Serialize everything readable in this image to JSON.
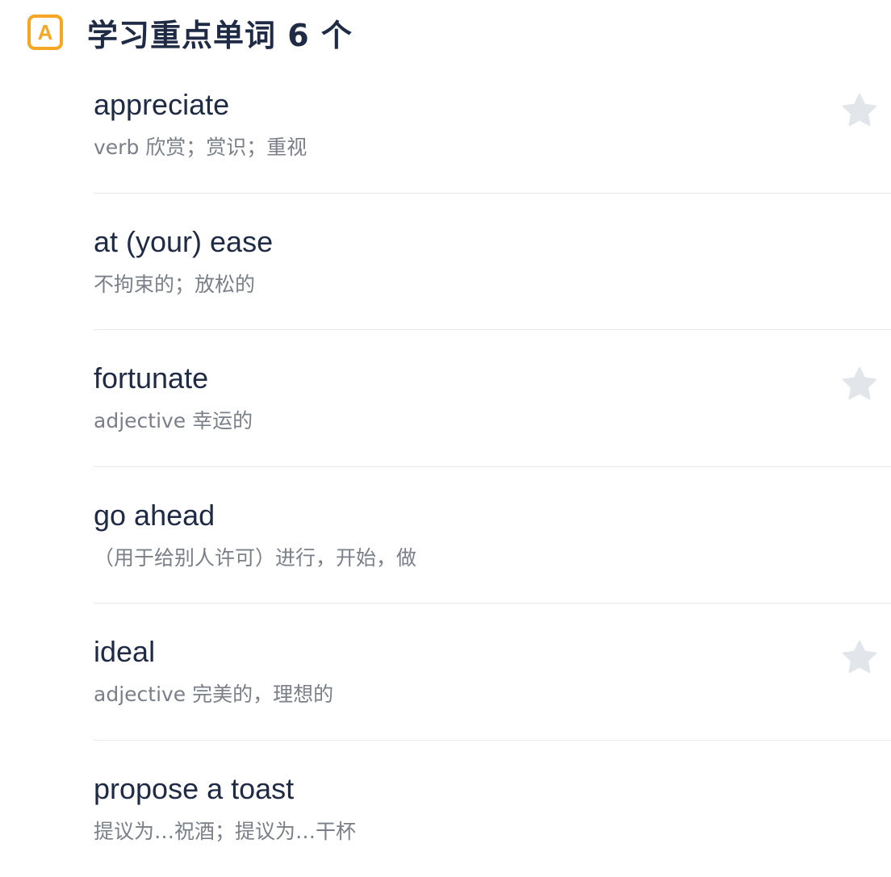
{
  "header": {
    "badge_letter": "A",
    "title": "学习重点单词 6 个"
  },
  "colors": {
    "accent": "#f5a623",
    "word_text": "#1f2a44",
    "definition_text": "#7a7f88",
    "star": "#e2e6ea",
    "divider": "#e6e8ec"
  },
  "words": [
    {
      "word": "appreciate",
      "definition": "verb 欣赏；赏识；重视",
      "star_icon": "star-icon",
      "has_star": true
    },
    {
      "word": "at (your) ease",
      "definition": "不拘束的；放松的",
      "has_star": false
    },
    {
      "word": "fortunate",
      "definition": "adjective 幸运的",
      "star_icon": "star-icon",
      "has_star": true
    },
    {
      "word": "go ahead",
      "definition": "（用于给别人许可）进行，开始，做",
      "has_star": false
    },
    {
      "word": "ideal",
      "definition": "adjective 完美的，理想的",
      "star_icon": "star-icon",
      "has_star": true
    },
    {
      "word": "propose a toast",
      "definition": "提议为…祝酒；提议为…干杯",
      "has_star": false
    }
  ]
}
